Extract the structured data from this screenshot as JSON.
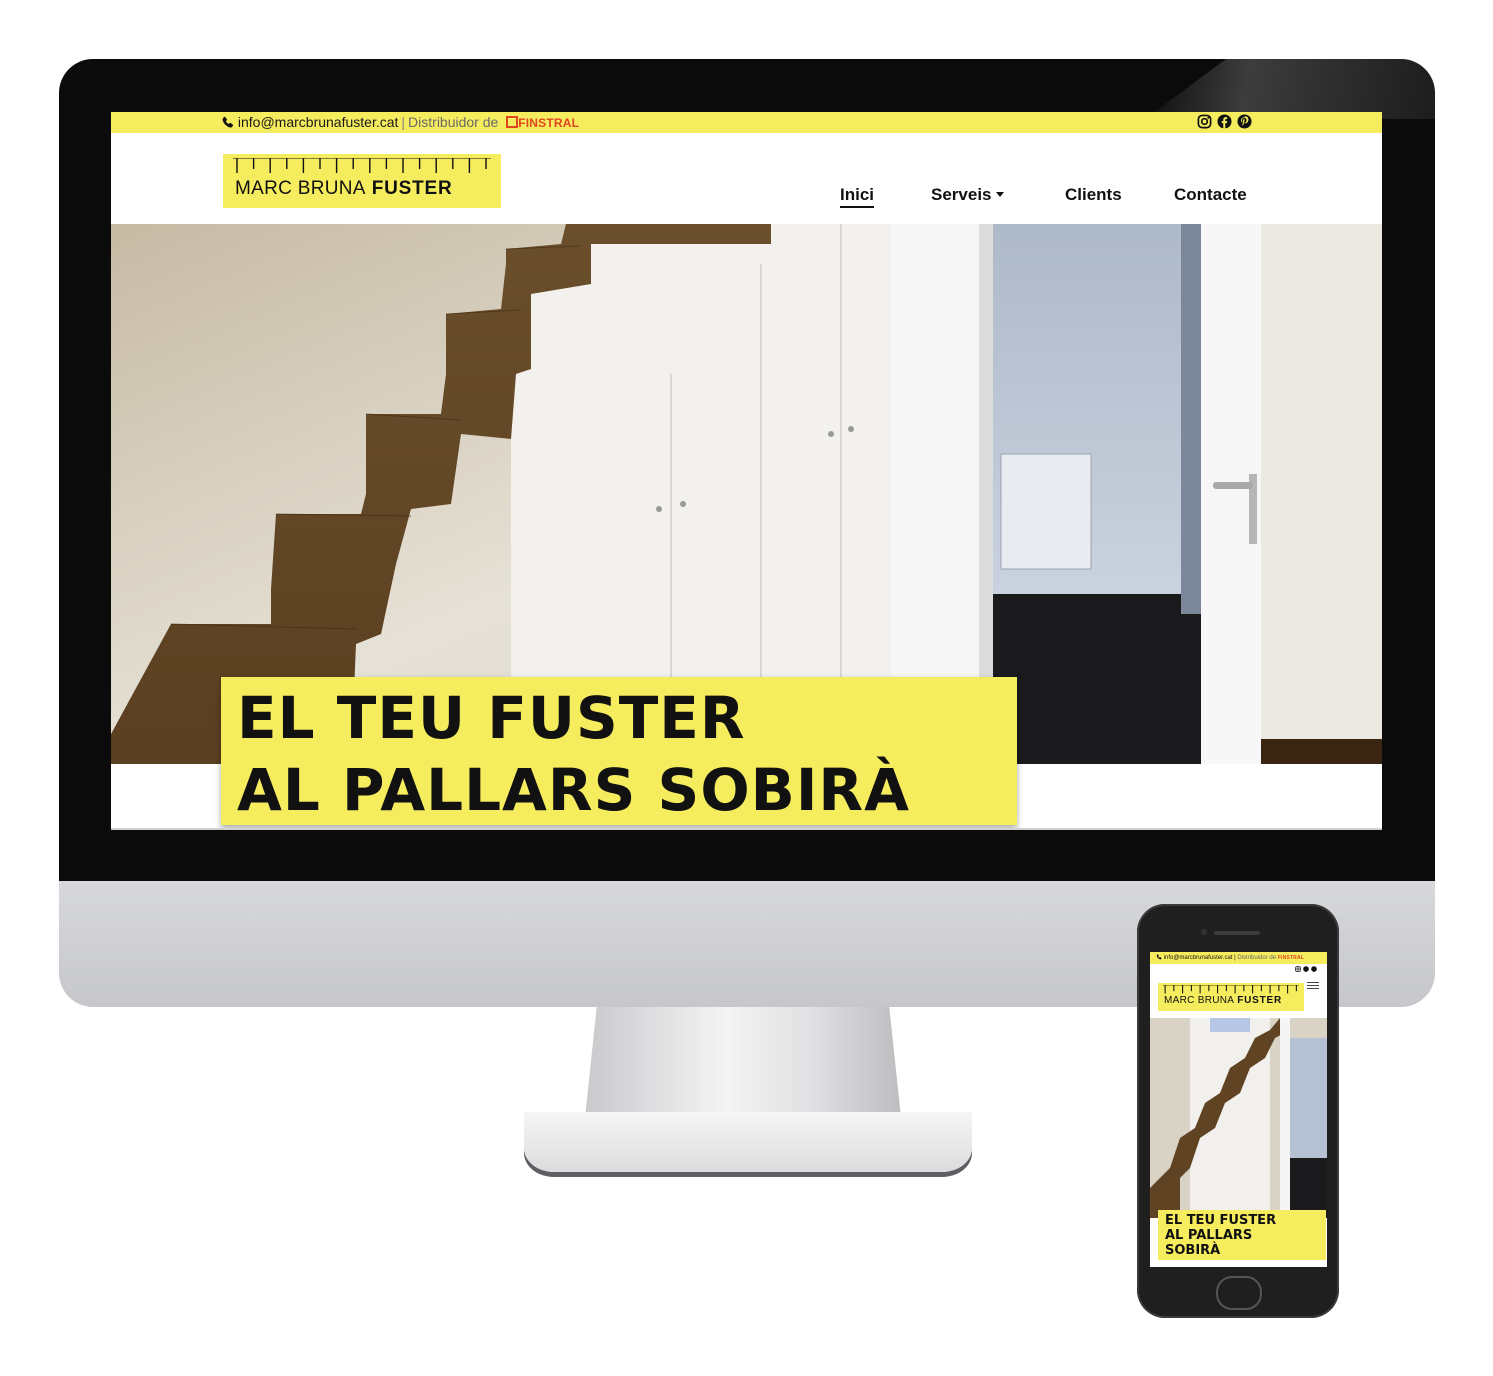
{
  "topbar": {
    "email": "info@marcbrunafuster.cat",
    "separator": "|",
    "distributor_label": "Distribuidor de",
    "distributor_brand": "FINSTRAL",
    "social_icons": [
      "instagram-icon",
      "facebook-icon",
      "pinterest-icon"
    ]
  },
  "logo": {
    "name_regular": "MARC BRUNA",
    "name_bold": "FUSTER"
  },
  "nav": {
    "items": [
      {
        "label": "Inici",
        "active": true
      },
      {
        "label": "Serveis",
        "has_dropdown": true
      },
      {
        "label": "Clients"
      },
      {
        "label": "Contacte"
      }
    ]
  },
  "hero": {
    "headline_line1": "EL TEU FUSTER",
    "headline_line2": "AL PALLARS SOBIRÀ"
  },
  "mobile": {
    "headline_line1": "EL TEU FUSTER",
    "headline_line2": "AL PALLARS",
    "headline_line3": "SOBIRÀ"
  },
  "colors": {
    "brand_yellow": "#f5ec5e",
    "finstral_orange": "#e0461f",
    "text": "#111111"
  }
}
